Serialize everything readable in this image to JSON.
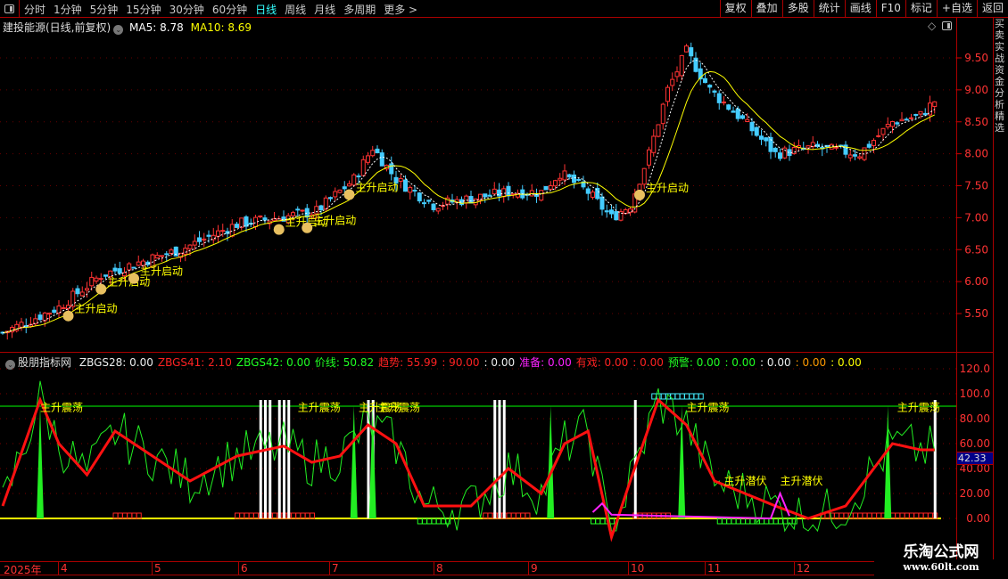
{
  "toolbar": {
    "periods": [
      "分时",
      "1分钟",
      "5分钟",
      "15分钟",
      "30分钟",
      "60分钟",
      "日线",
      "周线",
      "月线",
      "多周期",
      "更多 >"
    ],
    "active": "日线",
    "buttons": [
      "复权",
      "叠加",
      "多股",
      "统计",
      "画线",
      "F10",
      "标记",
      "+自选",
      "返回"
    ]
  },
  "title": {
    "name": "建投能源(日线,前复权)",
    "ma5": "MA5: 8.78",
    "ma10": "MA10: 8.69"
  },
  "indicator": {
    "name": "股朋指标网",
    "items": [
      {
        "t": "ZBGS28: 0.00",
        "c": "#eee"
      },
      {
        "t": "ZBGS41: 2.10",
        "c": "#f22"
      },
      {
        "t": "ZBGS42: 0.00",
        "c": "#2f2"
      },
      {
        "t": "价线: 50.82",
        "c": "#2f2"
      },
      {
        "t": "趋势: 55.99",
        "c": "#f22"
      },
      {
        "t": ": 90.00",
        "c": "#f22"
      },
      {
        "t": ": 0.00",
        "c": "#eee"
      },
      {
        "t": "准备: 0.00",
        "c": "#f2f"
      },
      {
        "t": "有戏: 0.00",
        "c": "#f22"
      },
      {
        "t": ": 0.00",
        "c": "#f22"
      },
      {
        "t": "预警: 0.00",
        "c": "#2f2"
      },
      {
        "t": ": 0.00",
        "c": "#2f2"
      },
      {
        "t": ": 0.00",
        "c": "#eee"
      },
      {
        "t": ": 0.00",
        "c": "#f90"
      },
      {
        "t": ": 0.00",
        "c": "#ff0"
      }
    ],
    "current_value": "42.33"
  },
  "chart_data": {
    "type": "candlestick",
    "price_axis": [
      "9.50",
      "9.00",
      "8.50",
      "8.00",
      "7.50",
      "7.00",
      "6.50",
      "6.00",
      "5.50"
    ],
    "price_range": [
      5.2,
      9.8
    ],
    "indicator_axis": [
      "120.0",
      "100.0",
      "80.00",
      "60.00",
      "40.00",
      "20.00",
      "0.00"
    ],
    "indicator_range": [
      -10,
      125
    ],
    "months": [
      "2025年",
      "4",
      "5",
      "6",
      "7",
      "8",
      "9",
      "10",
      "11",
      "12"
    ],
    "bars": 200,
    "close_keypoints": [
      [
        0,
        5.2
      ],
      [
        12,
        5.6
      ],
      [
        21,
        6.1
      ],
      [
        29,
        6.3
      ],
      [
        38,
        6.5
      ],
      [
        50,
        6.9
      ],
      [
        59,
        7.0
      ],
      [
        67,
        7.1
      ],
      [
        75,
        7.6
      ],
      [
        79,
        8.1
      ],
      [
        84,
        7.6
      ],
      [
        92,
        7.2
      ],
      [
        100,
        7.3
      ],
      [
        108,
        7.4
      ],
      [
        115,
        7.4
      ],
      [
        119,
        7.7
      ],
      [
        125,
        7.4
      ],
      [
        130,
        7.0
      ],
      [
        134,
        7.2
      ],
      [
        138,
        8.0
      ],
      [
        142,
        9.0
      ],
      [
        146,
        9.6
      ],
      [
        151,
        9.0
      ],
      [
        157,
        8.6
      ],
      [
        165,
        8.0
      ],
      [
        173,
        8.1
      ],
      [
        183,
        8.0
      ],
      [
        190,
        8.5
      ],
      [
        196,
        8.6
      ],
      [
        200,
        8.9
      ]
    ],
    "trend_keypoints": [
      [
        0,
        10
      ],
      [
        8,
        95
      ],
      [
        12,
        60
      ],
      [
        18,
        35
      ],
      [
        24,
        70
      ],
      [
        30,
        55
      ],
      [
        40,
        30
      ],
      [
        50,
        50
      ],
      [
        60,
        58
      ],
      [
        66,
        45
      ],
      [
        72,
        50
      ],
      [
        78,
        75
      ],
      [
        84,
        60
      ],
      [
        90,
        10
      ],
      [
        100,
        10
      ],
      [
        108,
        40
      ],
      [
        115,
        20
      ],
      [
        120,
        60
      ],
      [
        125,
        70
      ],
      [
        130,
        -15
      ],
      [
        134,
        30
      ],
      [
        140,
        95
      ],
      [
        146,
        75
      ],
      [
        152,
        30
      ],
      [
        165,
        10
      ],
      [
        172,
        0
      ],
      [
        180,
        10
      ],
      [
        186,
        40
      ],
      [
        190,
        60
      ],
      [
        196,
        55
      ],
      [
        200,
        55
      ]
    ],
    "signals": {
      "启动": {
        "label": "主升启动",
        "bars": [
          14,
          21,
          28,
          59,
          65,
          74,
          136
        ]
      },
      "震荡": {
        "label": "主升震荡",
        "bars": [
          8,
          63,
          76,
          80,
          146,
          191
        ]
      },
      "潜伏": {
        "label": "主升潜伏",
        "bars": [
          154,
          166
        ]
      }
    },
    "reference_line": 90
  },
  "watermark": {
    "line1": "乐淘公式网",
    "line2": "www.60lt.com"
  },
  "side_strip": "买卖实战资金分析精选"
}
